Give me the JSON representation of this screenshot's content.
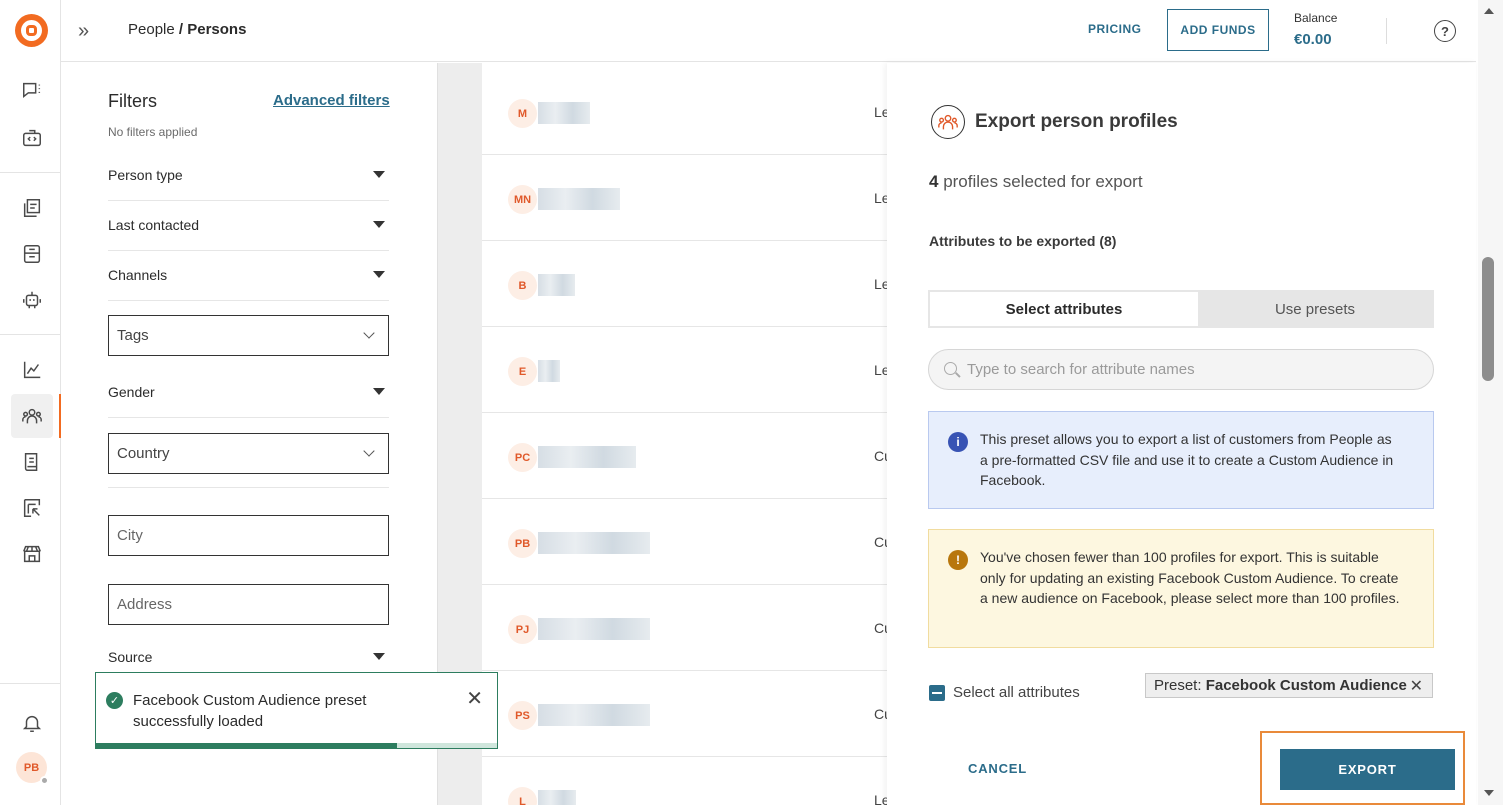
{
  "header": {
    "breadcrumb_parent": "People",
    "breadcrumb_sep": " / ",
    "breadcrumb_current": "Persons",
    "pricing": "PRICING",
    "add_funds": "ADD FUNDS",
    "balance_label": "Balance",
    "balance_value": "€0.00",
    "help": "?"
  },
  "rail": {
    "avatar_initials": "PB",
    "icons": [
      "conversations-icon",
      "code-icon",
      "templates-icon",
      "campaigns-icon",
      "bot-icon",
      "analytics-icon",
      "people-icon",
      "docs-icon",
      "reports-icon",
      "store-icon",
      "bell-icon"
    ]
  },
  "filters": {
    "title": "Filters",
    "advanced": "Advanced filters",
    "subtitle": "No filters applied",
    "person_type": "Person type",
    "last_contacted": "Last contacted",
    "channels": "Channels",
    "tags": "Tags",
    "gender": "Gender",
    "country": "Country",
    "city": "City",
    "address": "Address",
    "source": "Source"
  },
  "toast": {
    "message": "Facebook Custom Audience preset successfully loaded",
    "progress": 0.75
  },
  "list": {
    "rows": [
      {
        "initials": "M",
        "type": "Le"
      },
      {
        "initials": "MN",
        "type": "Le"
      },
      {
        "initials": "B",
        "type": "Le"
      },
      {
        "initials": "E",
        "type": "Le"
      },
      {
        "initials": "PC",
        "type": "Cu"
      },
      {
        "initials": "PB",
        "type": "Cu"
      },
      {
        "initials": "PJ",
        "type": "Cu"
      },
      {
        "initials": "PS",
        "type": "Cu"
      },
      {
        "initials": "L",
        "type": "Le"
      }
    ]
  },
  "panel": {
    "title": "Export person profiles",
    "count": "4",
    "count_suffix": " profiles selected for export",
    "attributes_title": "Attributes to be exported (8)",
    "tab_select": "Select attributes",
    "tab_presets": "Use presets",
    "search_placeholder": "Type to search for attribute names",
    "info_text": "This preset allows you to export a list of customers from People as a pre-formatted CSV file and use it to create a Custom Audience in Facebook.",
    "warn_text": "You've chosen fewer than 100 profiles for export. This is suitable only for updating an existing Facebook Custom Audience. To create a new audience on Facebook, please select more than 100 profiles.",
    "select_all": "Select all attributes",
    "preset_label": "Preset: ",
    "preset_name": "Facebook Custom Audience",
    "cancel": "CANCEL",
    "export": "EXPORT"
  },
  "colors": {
    "brand_orange": "#f26b21",
    "primary": "#2b6c8a",
    "success": "#2d7d5f",
    "info_bg": "#e7eefc",
    "warn_bg": "#fdf7e0"
  }
}
